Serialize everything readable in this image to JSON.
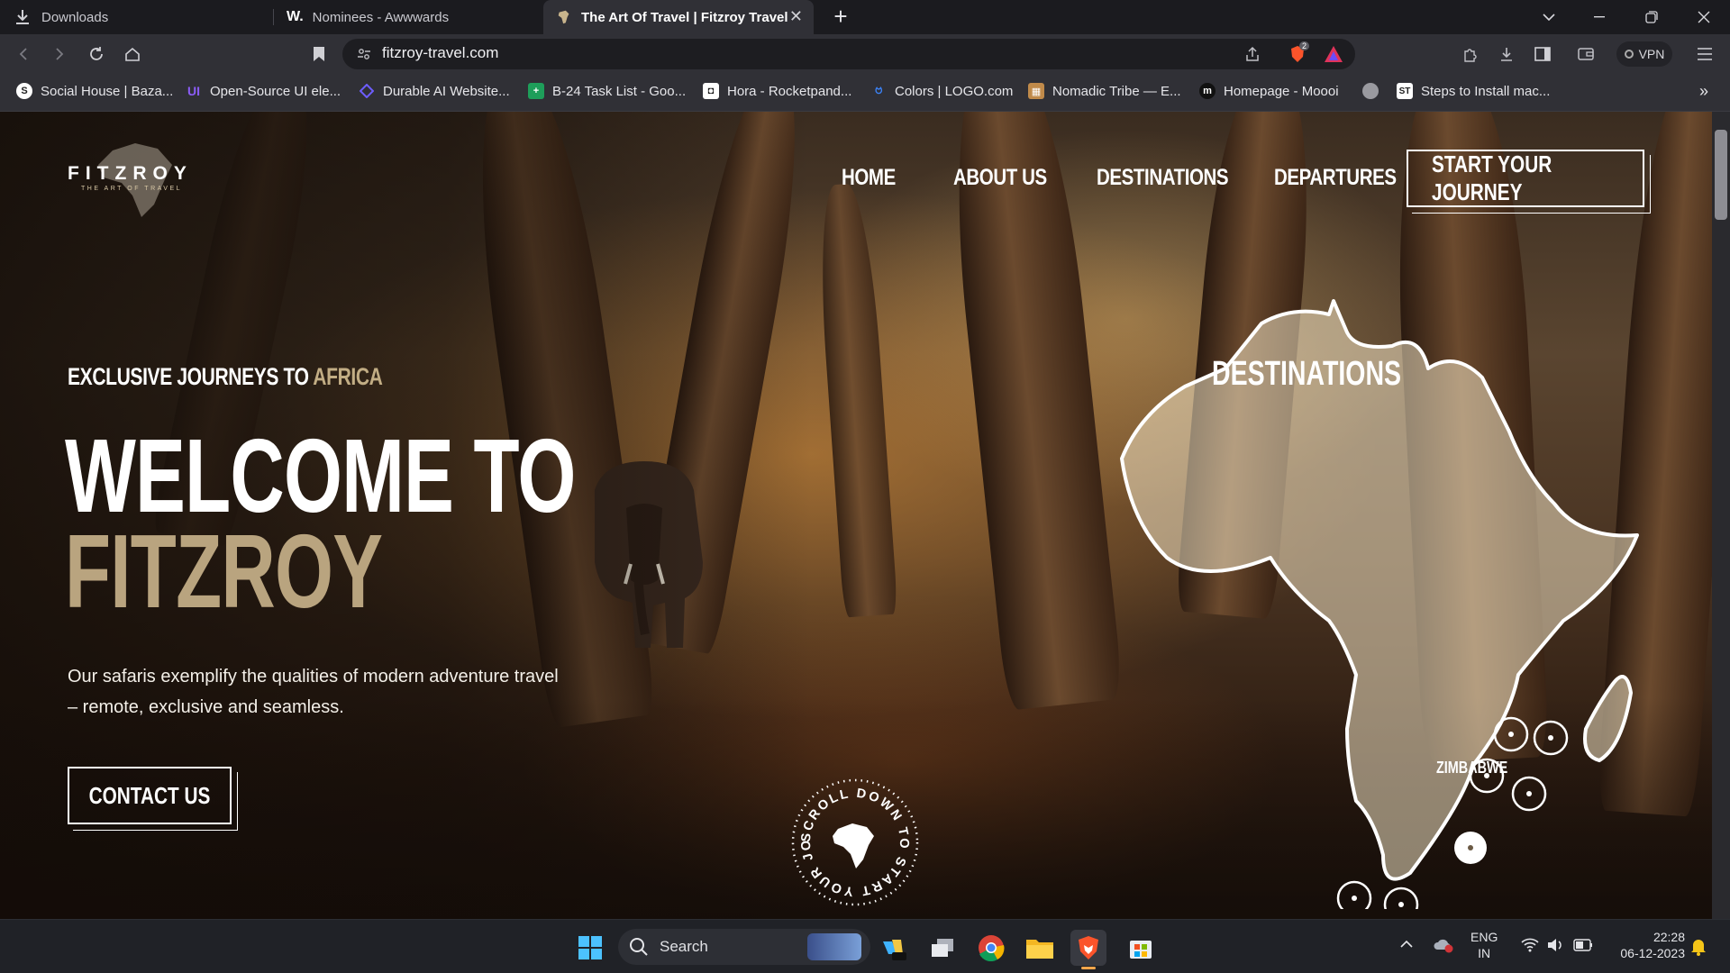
{
  "browser": {
    "tabs": [
      {
        "label": "Downloads",
        "icon": "download-icon",
        "active": false
      },
      {
        "label": "Nominees - Awwwards",
        "icon": "awwwards-w-icon",
        "active": false
      },
      {
        "label": "The Art Of Travel | Fitzroy Travel",
        "icon": "africa-favicon-icon",
        "active": true
      }
    ],
    "new_tab": "+",
    "url": "fitzroy-travel.com",
    "shields_count": "2",
    "vpn_label": "VPN",
    "bookmarks": [
      {
        "label": "Social House | Baza...",
        "icon": "social-house-icon",
        "color": "#f2f2f2"
      },
      {
        "label": "Open-Source UI ele...",
        "icon": "ui-icon",
        "color": "#8b5cf6"
      },
      {
        "label": "Durable AI Website...",
        "icon": "durable-icon",
        "color": "#6d5dfc"
      },
      {
        "label": "B-24 Task List - Goo...",
        "icon": "sheets-icon",
        "color": "#1e9e5a"
      },
      {
        "label": "Hora - Rocketpand...",
        "icon": "hora-icon",
        "color": "#ffffff"
      },
      {
        "label": "Colors | LOGO.com",
        "icon": "logo-com-icon",
        "color": "#3b82f6"
      },
      {
        "label": "Nomadic Tribe — E...",
        "icon": "nomadic-icon",
        "color": "#c08a4a"
      },
      {
        "label": "Homepage - Moooi",
        "icon": "moooi-icon",
        "color": "#111111"
      },
      {
        "label": "",
        "icon": "globe-icon",
        "color": "#9a9aa0"
      },
      {
        "label": "Steps to Install mac...",
        "icon": "st-icon",
        "color": "#ffffff"
      }
    ],
    "more_bookmarks": "»"
  },
  "site": {
    "logo": {
      "word": "FITZROY",
      "tagline": "THE ART OF TRAVEL"
    },
    "nav": [
      {
        "label": "HOME"
      },
      {
        "label": "ABOUT US"
      },
      {
        "label": "DESTINATIONS"
      },
      {
        "label": "DEPARTURES"
      }
    ],
    "cta": "START YOUR JOURNEY",
    "hero": {
      "eyebrow_main": "EXCLUSIVE JOURNEYS TO ",
      "eyebrow_accent": "AFRICA",
      "line1": "WELCOME TO",
      "line2": "FITZROY",
      "lede": "Our safaris exemplify the qualities of modern adventure travel – remote, exclusive and seamless.",
      "contact": "CONTACT US"
    },
    "map": {
      "title": "DESTINATIONS",
      "highlight_label": "ZIMBABWE"
    },
    "scroll_badge": "SCROLL DOWN TO START YOUR JOURNEY",
    "colors": {
      "accent": "#b9a47f",
      "eyebrow_accent": "#c2ad84"
    }
  },
  "taskbar": {
    "search_label": "Search",
    "lang": "ENG",
    "region": "IN",
    "time": "22:28",
    "date": "06-12-2023"
  }
}
